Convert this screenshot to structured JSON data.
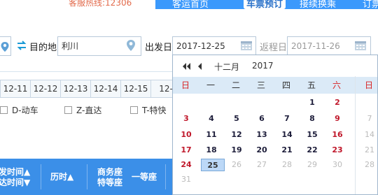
{
  "header": {
    "hotline": "客服热线:12306",
    "nav": [
      "客运首页",
      "车票预订",
      "接续换乘",
      "订票"
    ]
  },
  "search": {
    "to_label": "目的地",
    "to_value": "利川",
    "depart_label": "出发日",
    "depart_value": "2017-12-25",
    "return_label": "返程日",
    "return_value": "2017-11-26"
  },
  "date_tabs": [
    "12-11",
    "12-12",
    "12-13",
    "12-14",
    "12-15",
    "12-"
  ],
  "filters": [
    "D-动车",
    "Z-直达",
    "T-特快"
  ],
  "table_header": {
    "time": [
      "发时间▲",
      "达时间▼"
    ],
    "duration": "历时▲",
    "business": [
      "商务座",
      "特等座"
    ],
    "first": "一等座"
  },
  "calendar": {
    "month": "十二月",
    "year": "2017",
    "weekdays": [
      "日",
      "一",
      "二",
      "三",
      "四",
      "五",
      "六",
      "日"
    ],
    "rows": [
      [
        "",
        "",
        "",
        "",
        "",
        "1",
        "2",
        ""
      ],
      [
        "3",
        "4",
        "5",
        "6",
        "7",
        "8",
        "9",
        "7"
      ],
      [
        "10",
        "11",
        "12",
        "13",
        "14",
        "15",
        "16",
        "14"
      ],
      [
        "17",
        "18",
        "19",
        "20",
        "21",
        "22",
        "23",
        "21"
      ],
      [
        "24",
        "25",
        "26",
        "27",
        "28",
        "29",
        "30",
        "28"
      ],
      [
        "31",
        "",
        "",
        "",
        "",
        "",
        "",
        ""
      ]
    ],
    "selected": "25"
  },
  "colors": {
    "accent_blue": "#3b8fe8",
    "weekend_red": "#c0182b",
    "week_header_bg": "#dbeaf7"
  }
}
